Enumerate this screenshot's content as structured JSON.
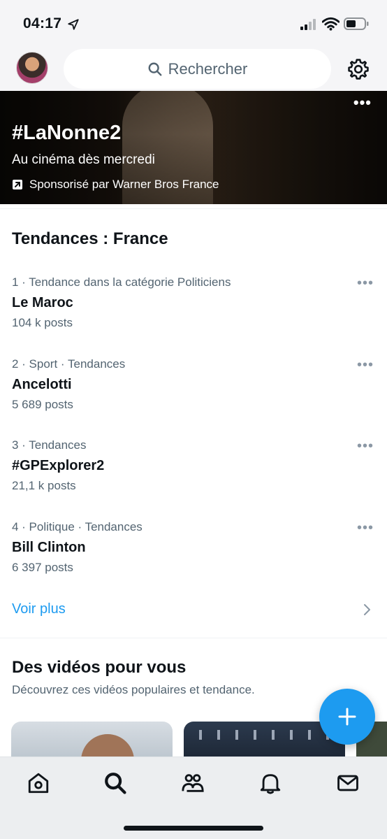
{
  "status_bar": {
    "time": "04:17"
  },
  "header": {
    "search_placeholder": "Rechercher"
  },
  "promo": {
    "title": "#LaNonne2",
    "subtitle": "Au cinéma dès mercredi",
    "sponsor": "Sponsorisé par Warner Bros France"
  },
  "trends": {
    "title": "Tendances : France",
    "items": [
      {
        "meta": "1 · Tendance dans la catégorie Politiciens",
        "name": "Le Maroc",
        "count": "104 k posts"
      },
      {
        "meta": "2 · Sport · Tendances",
        "name": "Ancelotti",
        "count": "5 689 posts"
      },
      {
        "meta": "3 · Tendances",
        "name": "#GPExplorer2",
        "count": "21,1 k posts"
      },
      {
        "meta": "4 · Politique · Tendances",
        "name": "Bill Clinton",
        "count": "6 397 posts"
      }
    ],
    "see_more": "Voir plus"
  },
  "videos": {
    "title": "Des vidéos pour vous",
    "subtitle": "Découvrez ces vidéos populaires et tendance."
  },
  "colors": {
    "accent": "#1d9bf0",
    "secondary_text": "#536471"
  },
  "tabbar": {
    "icons": [
      "home-icon",
      "search-icon",
      "communities-icon",
      "notifications-icon",
      "messages-icon"
    ],
    "active": "search-icon"
  }
}
